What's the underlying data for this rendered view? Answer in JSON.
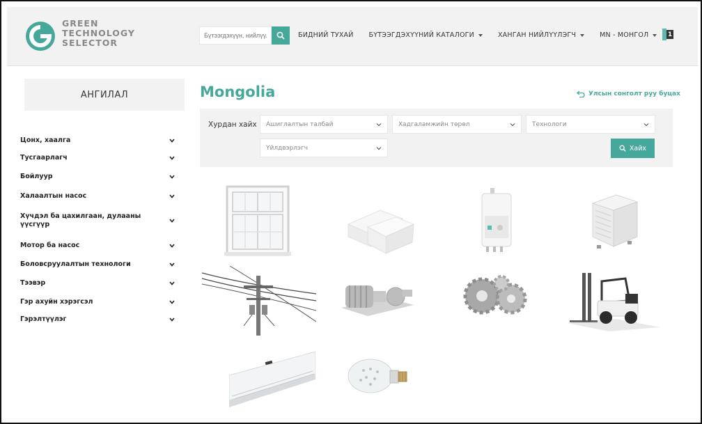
{
  "header": {
    "logo_line1": "GREEN",
    "logo_line2": "TECHNOLOGY",
    "logo_line3": "SELECTOR",
    "search_placeholder": "Бүтээгдэхүүн, нийлүүлэгч",
    "nav": [
      {
        "label": "БИДНИЙ ТУХАЙ",
        "has_caret": false
      },
      {
        "label": "БҮТЭЭГДЭХҮҮНИЙ КАТАЛОГИ",
        "has_caret": true
      },
      {
        "label": "ХАНГАН НИЙЛҮҮЛЭГЧ",
        "has_caret": true
      },
      {
        "label": "MN - МОНГОЛ",
        "has_caret": true
      }
    ],
    "cart_count": "1"
  },
  "sidebar": {
    "title": "АНГИЛАЛ",
    "categories": [
      "Цонх, хаалга",
      "Тусгаарлагч",
      "Бойлуур",
      "Халаалтын насос",
      "Хүчдэл ба цахилгаан, дулааны үүсгүүр",
      "Мотор ба насос",
      "Боловсруулалтын технологи",
      "Тээвэр",
      "Гэр ахуйн хэрэгсэл",
      "Гэрэлтүүлэг"
    ]
  },
  "main": {
    "title": "Mongolia",
    "back_link": "Улсын сонголт руу буцах",
    "filter": {
      "label": "Хурдан хайх",
      "selects": [
        "Ашиглалтын талбай",
        "Хадгаламжийн төрөл",
        "Технологи",
        "Үйлдвэрлэгч"
      ],
      "button": "Хайх"
    },
    "products": [
      {
        "icon": "window-icon"
      },
      {
        "icon": "insulation-icon"
      },
      {
        "icon": "boiler-icon"
      },
      {
        "icon": "heat-pump-icon"
      },
      {
        "icon": "power-line-icon"
      },
      {
        "icon": "motor-pump-icon"
      },
      {
        "icon": "gears-icon"
      },
      {
        "icon": "forklift-icon"
      },
      {
        "icon": "air-conditioner-icon"
      },
      {
        "icon": "light-bulb-icon"
      }
    ]
  },
  "colors": {
    "accent": "#46a89a",
    "panel": "#f2f2f2"
  }
}
